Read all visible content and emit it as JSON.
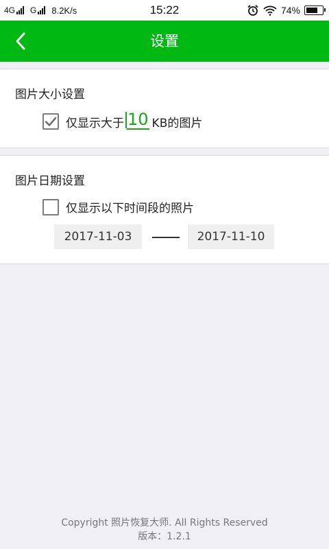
{
  "status_bar": {
    "network_1": "4G",
    "network_2": "G",
    "speed": "8.2K/s",
    "time": "15:22",
    "battery_percent": "74%",
    "battery_level": 0.74,
    "alarm_icon": "alarm-clock-icon",
    "wifi_icon": "wifi-icon"
  },
  "app_bar": {
    "title": "设置",
    "back_icon": "chevron-left-icon",
    "color": "#00b812"
  },
  "size_section": {
    "title": "图片大小设置",
    "checked": true,
    "label_prefix": "仅显示大于",
    "size_value": "10",
    "label_suffix": "KB的图片"
  },
  "date_section": {
    "title": "图片日期设置",
    "checked": false,
    "label": "仅显示以下时间段的照片",
    "start_date": "2017-11-03",
    "end_date": "2017-11-10"
  },
  "footer": {
    "copyright": "Copyright 照片恢复大师. All Rights Reserved",
    "version": "版本：1.2.1"
  }
}
